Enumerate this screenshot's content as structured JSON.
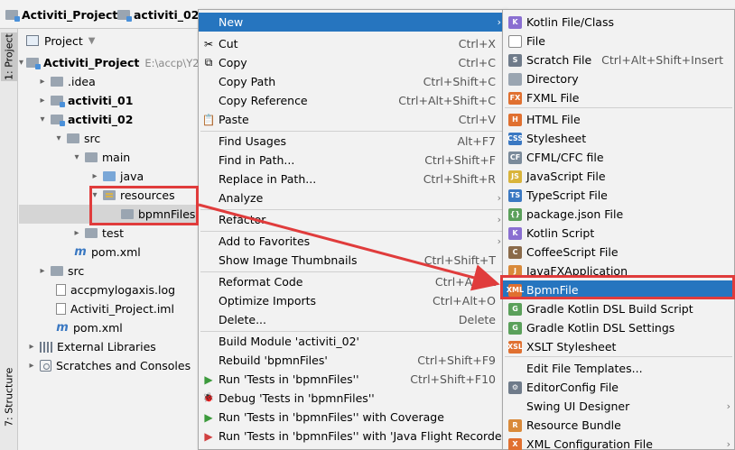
{
  "breadcrumb": [
    {
      "label": "Activiti_Project",
      "icon": "module-folder-icon"
    },
    {
      "label": "activiti_02",
      "icon": "module-folder-icon"
    }
  ],
  "side_tabs": {
    "project": "1: Project",
    "structure": "7: Structure"
  },
  "project_panel": {
    "title": "Project",
    "tree": [
      {
        "name": "root",
        "label": "Activiti_Project",
        "suffix": "E:\\accp\\Y2",
        "arrow": "▾",
        "bold": true
      },
      {
        "name": "idea",
        "label": ".idea",
        "arrow": "▸"
      },
      {
        "name": "activiti-01",
        "label": "activiti_01",
        "arrow": "▸",
        "bold": true
      },
      {
        "name": "activiti-02",
        "label": "activiti_02",
        "arrow": "▾",
        "bold": true
      },
      {
        "name": "src",
        "label": "src",
        "arrow": "▾"
      },
      {
        "name": "main",
        "label": "main",
        "arrow": "▾"
      },
      {
        "name": "java",
        "label": "java",
        "arrow": "▸"
      },
      {
        "name": "resources",
        "label": "resources",
        "arrow": "▾"
      },
      {
        "name": "bpmnfiles",
        "label": "bpmnFiles",
        "arrow": ""
      },
      {
        "name": "test",
        "label": "test",
        "arrow": "▸"
      },
      {
        "name": "pom-inner",
        "label": "pom.xml",
        "arrow": ""
      },
      {
        "name": "src-root",
        "label": "src",
        "arrow": "▸"
      },
      {
        "name": "log",
        "label": "accpmylogaxis.log",
        "arrow": ""
      },
      {
        "name": "iml",
        "label": "Activiti_Project.iml",
        "arrow": ""
      },
      {
        "name": "pom-root",
        "label": "pom.xml",
        "arrow": ""
      },
      {
        "name": "external-libraries",
        "label": "External Libraries",
        "arrow": "▸"
      },
      {
        "name": "scratches",
        "label": "Scratches and Consoles",
        "arrow": "▸"
      }
    ]
  },
  "context_menu": [
    {
      "label": "New",
      "shortcut": "",
      "submenu": true,
      "highlighted": true
    },
    {
      "label": "Cut",
      "shortcut": "Ctrl+X",
      "icon": "✂"
    },
    {
      "label": "Copy",
      "shortcut": "Ctrl+C",
      "icon": "⧉"
    },
    {
      "label": "Copy Path",
      "shortcut": "Ctrl+Shift+C"
    },
    {
      "label": "Copy Reference",
      "shortcut": "Ctrl+Alt+Shift+C"
    },
    {
      "label": "Paste",
      "shortcut": "Ctrl+V",
      "icon": "📋"
    },
    {
      "label": "Find Usages",
      "shortcut": "Alt+F7"
    },
    {
      "label": "Find in Path...",
      "shortcut": "Ctrl+Shift+F"
    },
    {
      "label": "Replace in Path...",
      "shortcut": "Ctrl+Shift+R"
    },
    {
      "label": "Analyze",
      "shortcut": "",
      "submenu": true
    },
    {
      "label": "Refactor",
      "shortcut": "",
      "submenu": true
    },
    {
      "label": "Add to Favorites",
      "shortcut": "",
      "submenu": true
    },
    {
      "label": "Show Image Thumbnails",
      "shortcut": "Ctrl+Shift+T"
    },
    {
      "label": "Reformat Code",
      "shortcut": "Ctrl+Alt+L"
    },
    {
      "label": "Optimize Imports",
      "shortcut": "Ctrl+Alt+O"
    },
    {
      "label": "Delete...",
      "shortcut": "Delete"
    },
    {
      "label": "Build Module 'activiti_02'",
      "shortcut": ""
    },
    {
      "label": "Rebuild 'bpmnFiles'",
      "shortcut": "Ctrl+Shift+F9"
    },
    {
      "label": "Run 'Tests in 'bpmnFiles''",
      "shortcut": "Ctrl+Shift+F10",
      "icon": "▶",
      "icon_color": "#3c9a3c"
    },
    {
      "label": "Debug 'Tests in 'bpmnFiles''",
      "shortcut": "",
      "icon": "🐞",
      "icon_color": "#3c9a3c"
    },
    {
      "label": "Run 'Tests in 'bpmnFiles'' with Coverage",
      "shortcut": "",
      "icon": "▶",
      "icon_color": "#3c9a3c"
    },
    {
      "label": "Run 'Tests in 'bpmnFiles'' with 'Java Flight Recorder'",
      "shortcut": "",
      "icon": "▶",
      "icon_color": "#d04040"
    }
  ],
  "new_submenu": [
    {
      "label": "Kotlin File/Class",
      "icon": "K",
      "color": "#8a6fd1"
    },
    {
      "label": "File",
      "icon": "",
      "color": "#ffffff"
    },
    {
      "label": "Scratch File",
      "shortcut": "Ctrl+Alt+Shift+Insert",
      "icon": "S",
      "color": "#6f7b8a"
    },
    {
      "label": "Directory",
      "icon": "",
      "color": "#9aa5b1"
    },
    {
      "label": "FXML File",
      "icon": "FX",
      "color": "#e07030"
    },
    {
      "label": "HTML File",
      "icon": "H",
      "color": "#e07030"
    },
    {
      "label": "Stylesheet",
      "icon": "CSS",
      "color": "#3a78c2"
    },
    {
      "label": "CFML/CFC file",
      "icon": "CF",
      "color": "#7a8a9a"
    },
    {
      "label": "JavaScript File",
      "icon": "JS",
      "color": "#d9b43a"
    },
    {
      "label": "TypeScript File",
      "icon": "TS",
      "color": "#3a78c2"
    },
    {
      "label": "package.json File",
      "icon": "{}",
      "color": "#5aa05a"
    },
    {
      "label": "Kotlin Script",
      "icon": "K",
      "color": "#8a6fd1"
    },
    {
      "label": "CoffeeScript File",
      "icon": "C",
      "color": "#8a6a4a"
    },
    {
      "label": "JavaFXApplication",
      "icon": "J",
      "color": "#d98a3a"
    },
    {
      "label": "BpmnFile",
      "icon": "XML",
      "color": "#e07030",
      "highlighted": true
    },
    {
      "label": "Gradle Kotlin DSL Build Script",
      "icon": "G",
      "color": "#5aa05a"
    },
    {
      "label": "Gradle Kotlin DSL Settings",
      "icon": "G",
      "color": "#5aa05a"
    },
    {
      "label": "XSLT Stylesheet",
      "icon": "XSL",
      "color": "#e07030"
    },
    {
      "label": "Edit File Templates...",
      "icon": "",
      "color": "transparent"
    },
    {
      "label": "EditorConfig File",
      "icon": "⚙",
      "color": "#6f7b8a"
    },
    {
      "label": "Swing UI Designer",
      "icon": "",
      "color": "transparent",
      "submenu": true
    },
    {
      "label": "Resource Bundle",
      "icon": "R",
      "color": "#d98a3a"
    },
    {
      "label": "XML Configuration File",
      "icon": "X",
      "color": "#e07030",
      "submenu": true
    }
  ],
  "annotation_color": "#e03c3c"
}
